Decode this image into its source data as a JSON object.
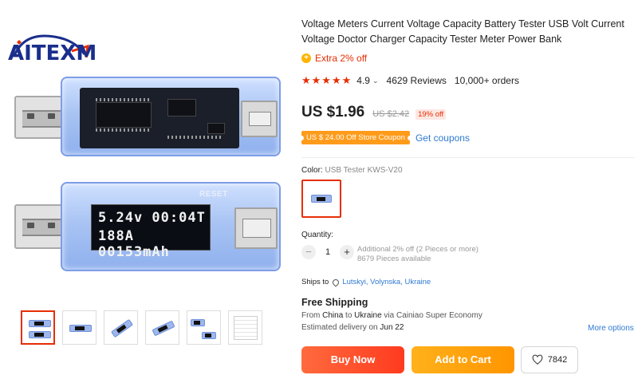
{
  "brand": {
    "logo_text": "AITEXM"
  },
  "lcd": {
    "line1": "5.24v 00:04T",
    "line2": "188A 00153mAh",
    "reset_label": "RESET"
  },
  "product": {
    "title": "Voltage Meters Current Voltage Capacity Battery Tester USB Volt Current Voltage Doctor Charger Capacity Tester Meter Power Bank",
    "extra_offer": "Extra 2% off",
    "rating": {
      "stars": "★★★★★",
      "score": "4.9",
      "reviews": "4629 Reviews",
      "orders": "10,000+ orders"
    },
    "price": {
      "current": "US $1.96",
      "original": "US $2.42",
      "discount": "19% off"
    },
    "coupon": {
      "label": "US $ 24.00 Off Store Coupon",
      "link": "Get coupons"
    },
    "color": {
      "label": "Color:",
      "selected": "USB Tester KWS-V20"
    },
    "quantity": {
      "label": "Quantity:",
      "value": "1",
      "minus": "−",
      "plus": "+",
      "info_line1": "Additional 2% off (2 Pieces or more)",
      "info_line2": "8679 Pieces available"
    },
    "shipping": {
      "ships_to_label": "Ships to",
      "ships_to_location": "Lutskyi, Volynska, Ukraine",
      "title": "Free Shipping",
      "from_prefix": "From",
      "from_country": "China",
      "to_word": "to",
      "to_country": "Ukraine",
      "via": "via Cainiao Super Economy",
      "eta_prefix": "Estimated delivery on",
      "eta_date": "Jun 22",
      "more_options": "More options"
    },
    "actions": {
      "buy_now": "Buy Now",
      "add_to_cart": "Add to Cart",
      "wishlist_count": "7842"
    }
  },
  "colors": {
    "accent_red": "#e62e04",
    "link_blue": "#2f7ad1",
    "buy_now": "#ff4a26",
    "add_to_cart": "#ffa10f",
    "coupon_orange": "#ff9b1a",
    "logo_blue": "#1a2e8c"
  },
  "icons": {
    "coin": "coin-icon",
    "location": "location-pin-icon",
    "heart": "heart-icon",
    "chevron": "chevron-down-icon"
  }
}
